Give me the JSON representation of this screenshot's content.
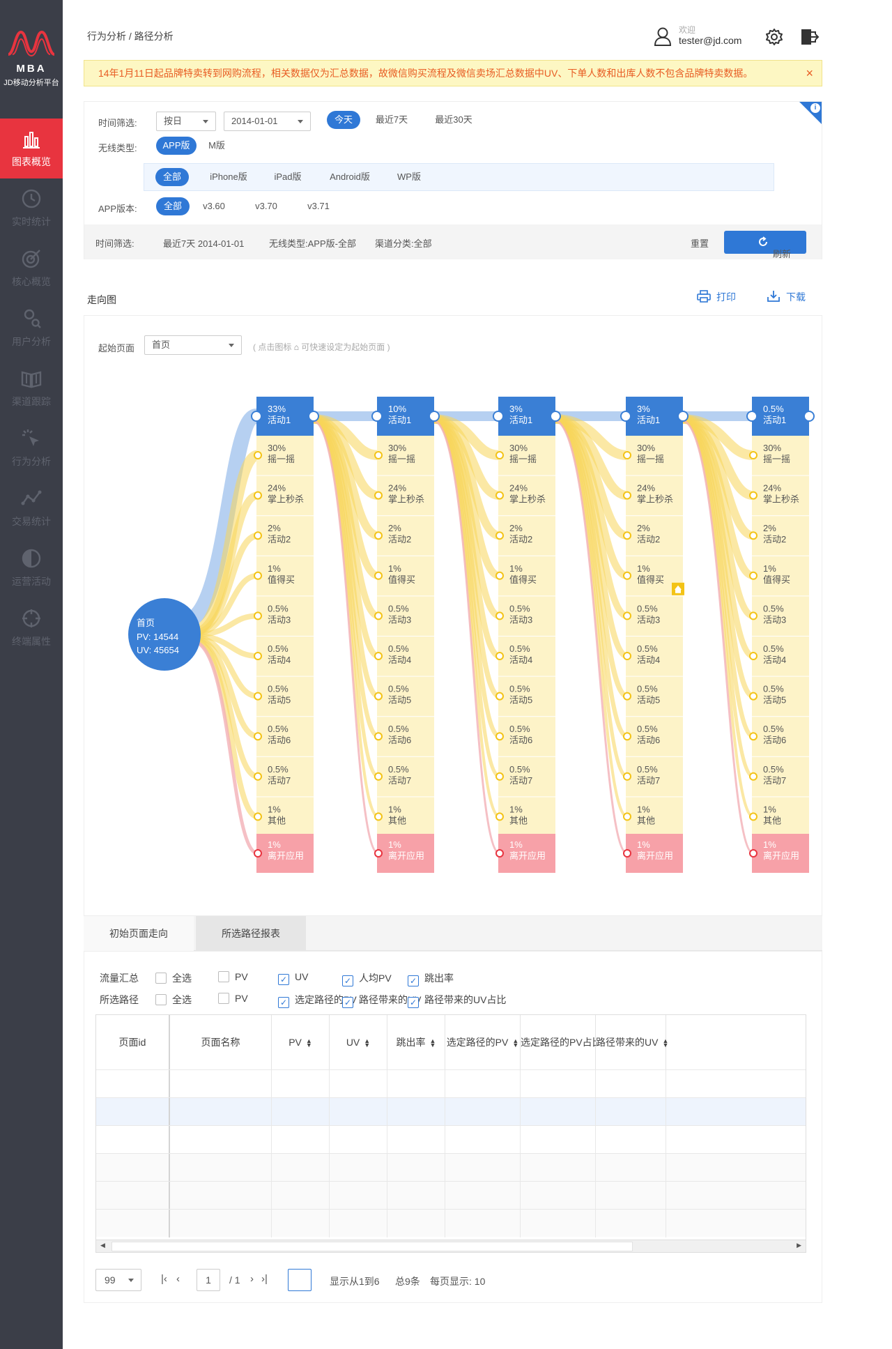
{
  "sidebar": {
    "logo_text": "MBA",
    "logo_sub": "JD移动分析平台",
    "items": [
      {
        "label": "图表概览",
        "icon": "bar-chart-icon",
        "active": true
      },
      {
        "label": "实时统计",
        "icon": "clock-icon"
      },
      {
        "label": "核心概览",
        "icon": "target-icon"
      },
      {
        "label": "用户分析",
        "icon": "user-search-icon"
      },
      {
        "label": "渠道跟踪",
        "icon": "book-icon"
      },
      {
        "label": "行为分析",
        "icon": "cursor-click-icon"
      },
      {
        "label": "交易统计",
        "icon": "line-nodes-icon"
      },
      {
        "label": "运营活动",
        "icon": "half-circle-icon"
      },
      {
        "label": "终端属性",
        "icon": "crosshair-icon"
      }
    ]
  },
  "header": {
    "breadcrumb": "行为分析 / 路径分析",
    "welcome": "欢迎",
    "email": "tester@jd.com"
  },
  "notice": {
    "text": "14年1月11日起品牌特卖转到网购流程，相关数据仅为汇总数据，故微信购买流程及微信卖场汇总数据中UV、下单人数和出库人数不包含品牌特卖数据。",
    "close": "×"
  },
  "filter": {
    "time_label": "时间筛选:",
    "granularity": "按日",
    "date": "2014-01-01",
    "quick": [
      "今天",
      "最近7天",
      "最近30天"
    ],
    "wireless_label": "无线类型:",
    "wireless": [
      "APP版",
      "M版"
    ],
    "platforms": [
      "全部",
      "iPhone版",
      "iPad版",
      "Android版",
      "WP版"
    ],
    "version_label": "APP版本:",
    "versions": [
      "全部",
      "v3.60",
      "v3.70",
      "v3.71"
    ],
    "summary_label": "时间筛选:",
    "summary_time": "最近7天 2014-01-01",
    "summary_wireless": "无线类型:APP版-全部",
    "summary_channel": "渠道分类:全部",
    "reset": "重置",
    "refresh": "刷新",
    "info_icon": "i"
  },
  "flow": {
    "title": "走向图",
    "print": "打印",
    "download": "下载",
    "start_label": "起始页面",
    "start_value": "首页",
    "hint_before": "( 点击图标",
    "hint_after": "可快速设定为起始页面 )",
    "root": {
      "name": "首页",
      "pv": "PV: 14544",
      "uv": "UV: 45654"
    },
    "columns": [
      {
        "head": [
          "33%",
          "活动1"
        ]
      },
      {
        "head": [
          "10%",
          "活动1"
        ]
      },
      {
        "head": [
          "3%",
          "活动1"
        ]
      },
      {
        "head": [
          "3%",
          "活动1"
        ]
      },
      {
        "head": [
          "0.5%",
          "活动1"
        ]
      }
    ],
    "nodes": [
      [
        "30%",
        "摇一摇"
      ],
      [
        "24%",
        "掌上秒杀"
      ],
      [
        "2%",
        "活动2"
      ],
      [
        "1%",
        "值得买"
      ],
      [
        "0.5%",
        "活动3"
      ],
      [
        "0.5%",
        "活动4"
      ],
      [
        "0.5%",
        "活动5"
      ],
      [
        "0.5%",
        "活动6"
      ],
      [
        "0.5%",
        "活动7"
      ],
      [
        "1%",
        "其他"
      ]
    ],
    "exit_node": [
      "1%",
      "离开应用"
    ],
    "colors": {
      "head": "#3a7fd5",
      "node": "#fdf3c8",
      "exit": "#f7a1a8",
      "flow": "#f8d65a",
      "flow_head": "#a9c8ee",
      "flow_exit": "#f3b0b6",
      "home_badge": "#f3c316"
    }
  },
  "tabs": [
    "初始页面走向",
    "所选路径报表"
  ],
  "checkboxes": {
    "row1_label": "流量汇总",
    "row1": [
      {
        "label": "全选",
        "checked": false
      },
      {
        "label": "PV",
        "checked": false
      },
      {
        "label": "UV",
        "checked": true
      },
      {
        "label": "人均PV",
        "checked": true
      },
      {
        "label": "跳出率",
        "checked": true
      }
    ],
    "row2_label": "所选路径",
    "row2": [
      {
        "label": "全选",
        "checked": false
      },
      {
        "label": "PV",
        "checked": false
      },
      {
        "label": "选定路径的PV",
        "checked": true
      },
      {
        "label": "路径带来的UV",
        "checked": true
      },
      {
        "label": "路径带来的UV占比",
        "checked": true
      }
    ]
  },
  "table": {
    "columns": [
      "页面id",
      "页面名称",
      "PV",
      "UV",
      "跳出率",
      "选定路径的PV",
      "选定路径的PV占比",
      "路径带来的UV"
    ],
    "sortable": [
      false,
      false,
      true,
      true,
      true,
      true,
      false,
      true
    ]
  },
  "pager": {
    "page_size": "99",
    "page": "1",
    "total_pages": "/ 1",
    "range": "显示从1到6",
    "total": "总9条",
    "per_page": "每页显示: 10"
  }
}
